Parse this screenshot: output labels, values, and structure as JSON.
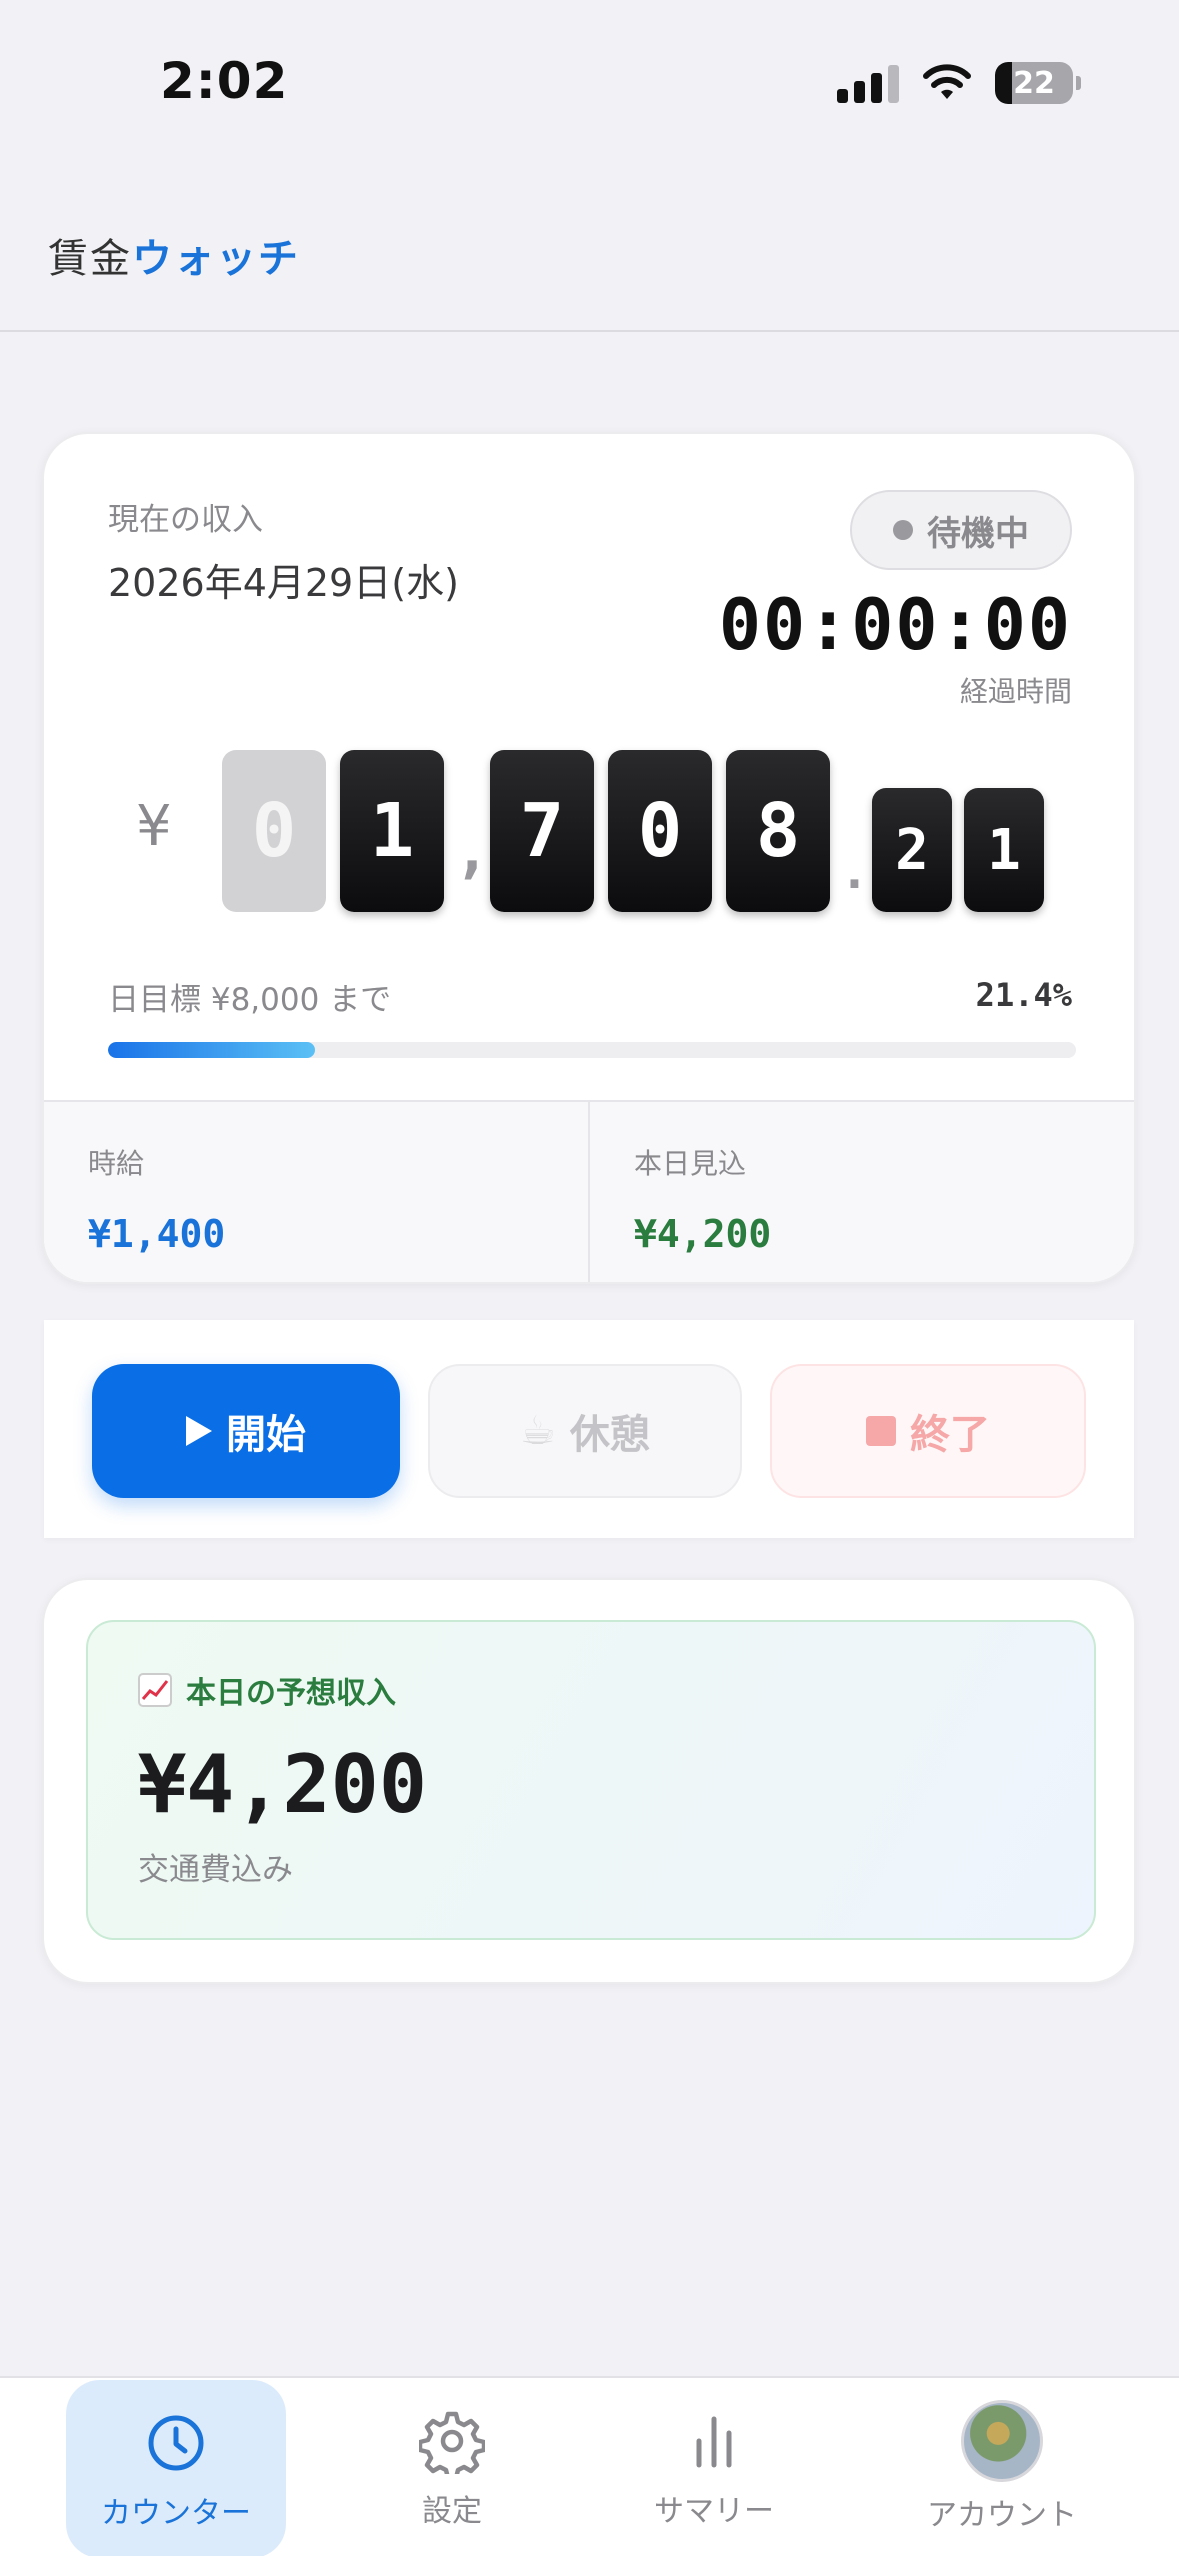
{
  "status_bar": {
    "time": "2:02",
    "battery": "22",
    "battery_level": 0.22
  },
  "header": {
    "title_part1": "賃金",
    "title_part2": "ウォッチ"
  },
  "earnings_card": {
    "label": "現在の収入",
    "date": "2026年4月29日(水)",
    "status": "待機中",
    "elapsed_time": "00:00:00",
    "elapsed_label": "経過時間",
    "currency_symbol": "¥",
    "digits": [
      "0",
      "1",
      "7",
      "0",
      "8"
    ],
    "thousands_separator": ",",
    "decimal_separator": ".",
    "decimals": [
      "2",
      "1"
    ],
    "goal_label": "日目標 ¥8,000 まで",
    "goal_percent_text": "21.4%",
    "goal_progress": 0.214,
    "hourly_label": "時給",
    "hourly_value": "¥1,400",
    "today_forecast_label": "本日見込",
    "today_forecast_value": "¥4,200"
  },
  "controls": {
    "start_label": "開始",
    "break_label": "休憩",
    "break_icon": "☕",
    "stop_label": "終了"
  },
  "forecast_card": {
    "title": "本日の予想収入",
    "icon": "chart-increasing-icon",
    "value": "¥4,200",
    "note": "交通費込み"
  },
  "tabs": [
    {
      "label": "カウンター",
      "icon": "clock-icon",
      "active": true
    },
    {
      "label": "設定",
      "icon": "gear-icon",
      "active": false
    },
    {
      "label": "サマリー",
      "icon": "bar-chart-icon",
      "active": false
    },
    {
      "label": "アカウント",
      "icon": "avatar",
      "active": false
    }
  ],
  "colors": {
    "accent": "#0a6fe6",
    "accent_text": "#1a73d9",
    "green": "#2a7d3e",
    "stop": "#f6a7a7"
  }
}
